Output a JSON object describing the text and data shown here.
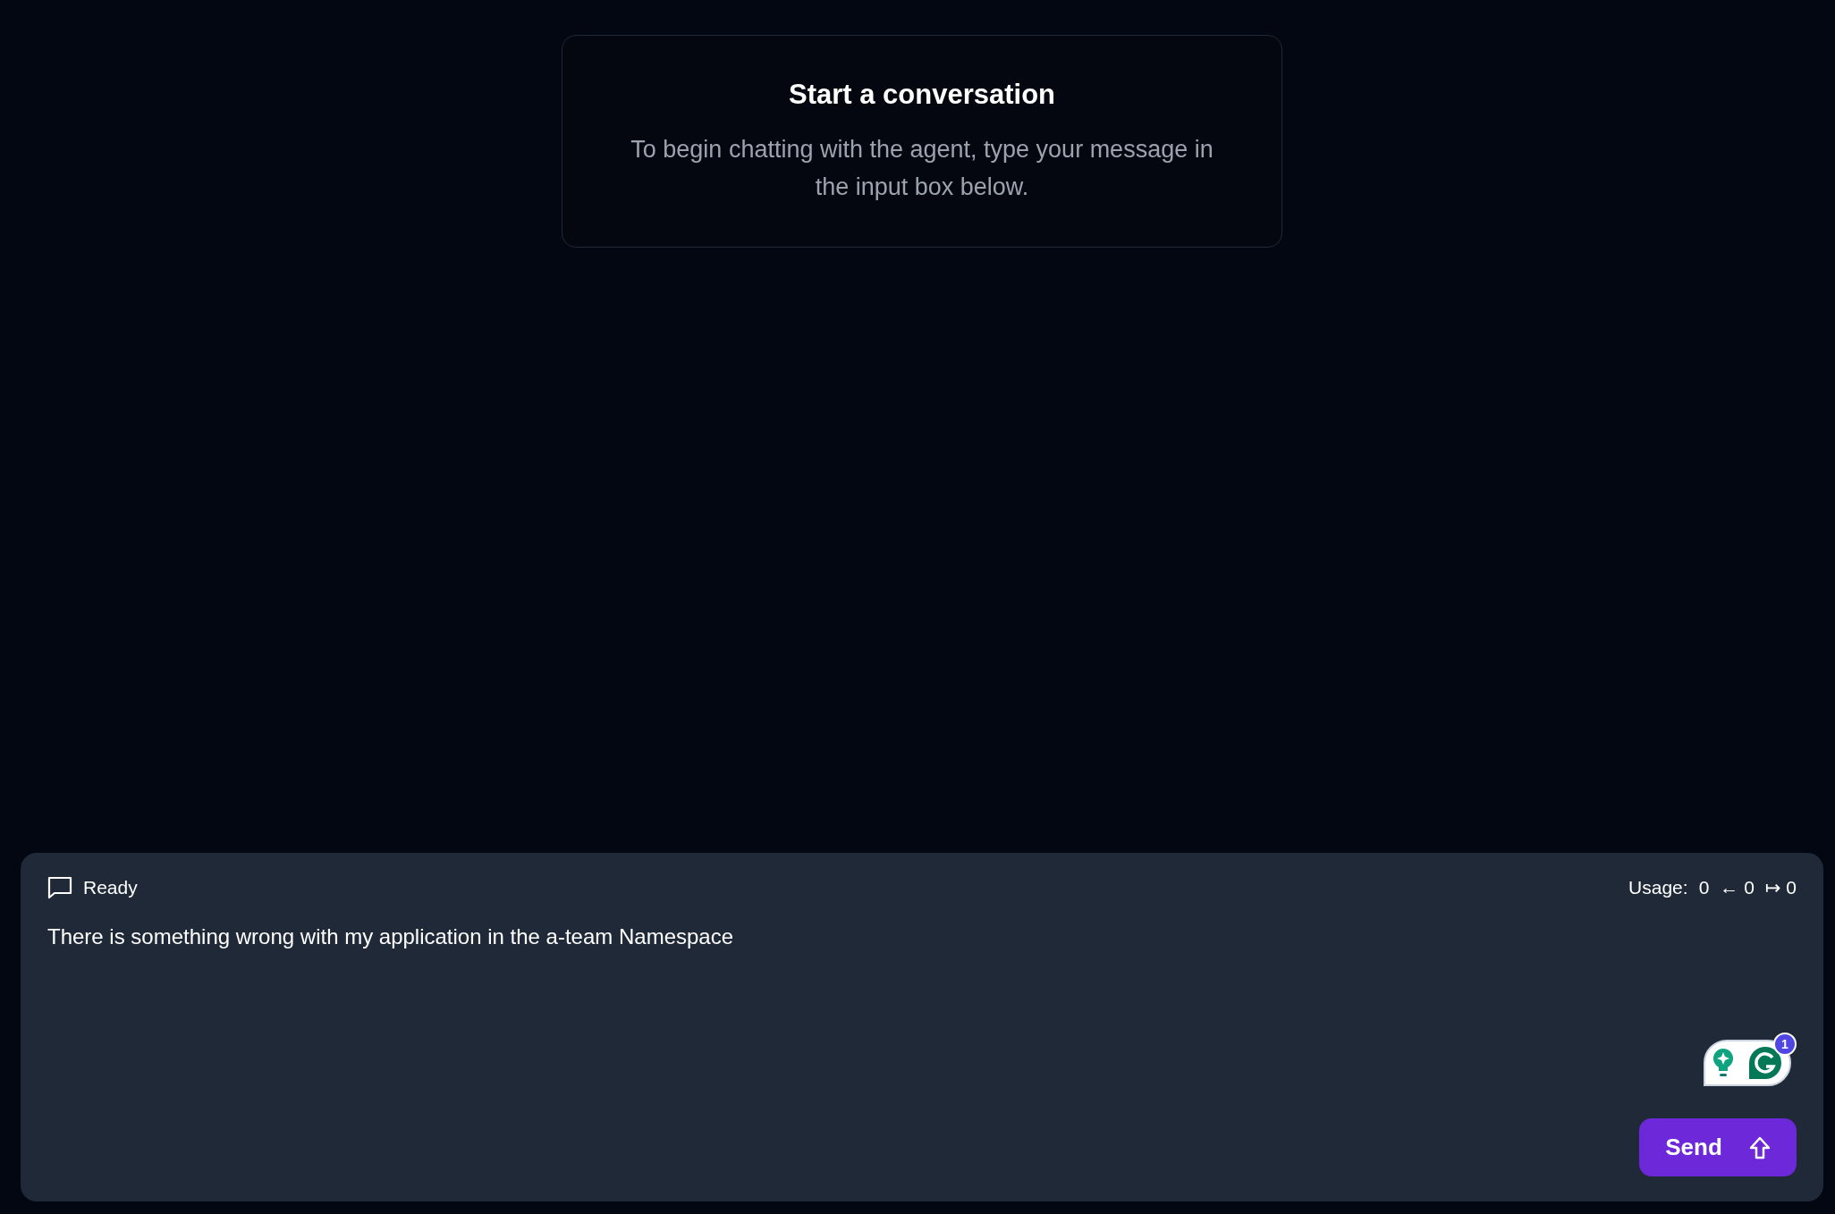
{
  "intro": {
    "title": "Start a conversation",
    "text": "To begin chatting with the agent, type your message in the input box below."
  },
  "composer": {
    "status": "Ready",
    "usage": {
      "label": "Usage:",
      "total": "0",
      "input_arrow": "←",
      "input": "0",
      "output_arrow": "↦",
      "output": "0"
    },
    "message": "There is something wrong with my application in the a-team Namespace",
    "assistant_badge": "1",
    "send_label": "Send"
  }
}
